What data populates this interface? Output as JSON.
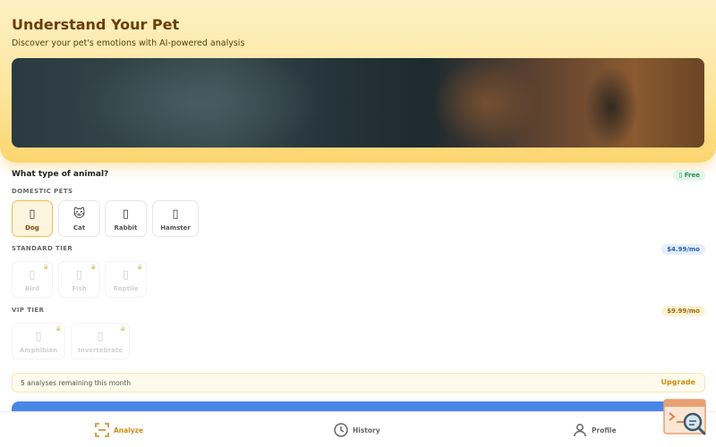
{
  "hero": {
    "title": "Understand Your Pet",
    "subtitle": "Discover your pet's emotions with AI-powered analysis"
  },
  "question": "What type of animal?",
  "tiers": {
    "domestic": {
      "label": "DOMESTIC PETS",
      "badge": "Free",
      "badge_icon": "gift-icon",
      "items": [
        {
          "label": "Dog",
          "icon": "dog-icon",
          "glyph": "🐕",
          "selected": true
        },
        {
          "label": "Cat",
          "icon": "cat-icon",
          "glyph": "🐱",
          "selected": false
        },
        {
          "label": "Rabbit",
          "icon": "rabbit-icon",
          "glyph": "🐇",
          "selected": false
        },
        {
          "label": "Hamster",
          "icon": "hamster-icon",
          "glyph": "🐹",
          "selected": false
        }
      ]
    },
    "standard": {
      "label": "STANDARD TIER",
      "badge": "$4.99/mo",
      "items": [
        {
          "label": "Bird",
          "icon": "bird-icon",
          "glyph": "🐦",
          "locked": true
        },
        {
          "label": "Fish",
          "icon": "fish-icon",
          "glyph": "🐟",
          "locked": true
        },
        {
          "label": "Reptile",
          "icon": "reptile-icon",
          "glyph": "🦎",
          "locked": true
        }
      ]
    },
    "vip": {
      "label": "VIP TIER",
      "badge": "$9.99/mo",
      "items": [
        {
          "label": "Amphibian",
          "icon": "amphibian-icon",
          "glyph": "🐸",
          "locked": true
        },
        {
          "label": "Invertebrate",
          "icon": "invertebrate-icon",
          "glyph": "🦋",
          "locked": true
        }
      ]
    }
  },
  "quota": {
    "text": "5 analyses remaining this month",
    "action": "Upgrade"
  },
  "nav": {
    "items": [
      {
        "label": "Analyze",
        "icon": "scan-icon",
        "active": true
      },
      {
        "label": "History",
        "icon": "clock-icon",
        "active": false
      },
      {
        "label": "Profile",
        "icon": "user-icon",
        "active": false
      }
    ]
  },
  "colors": {
    "accent": "#d08a10",
    "primary_button": "#4a86e8",
    "hero_bg": "#fde49a"
  }
}
